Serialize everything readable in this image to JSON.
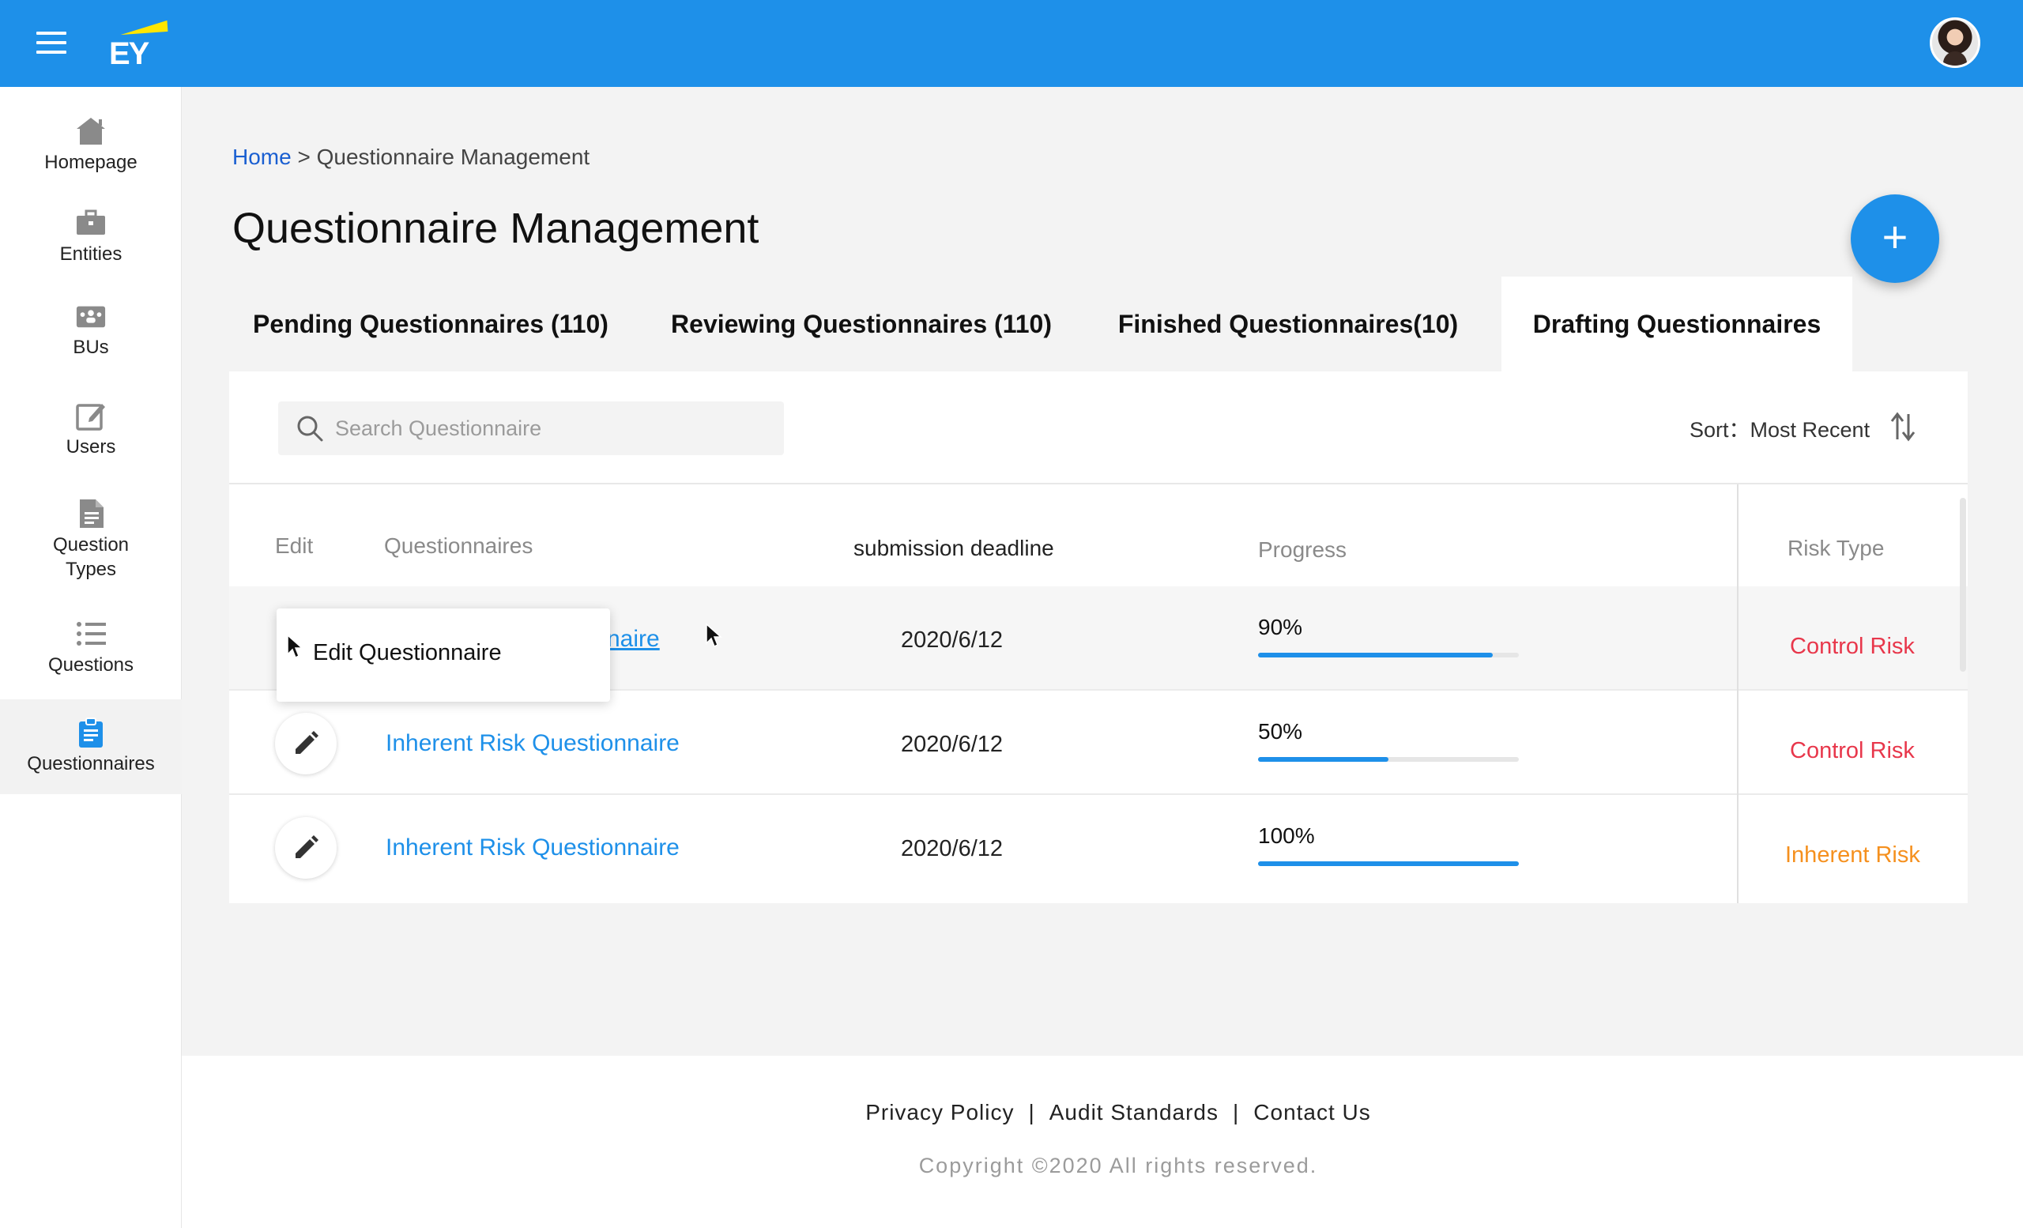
{
  "header": {
    "logo_text": "EY",
    "colors": {
      "bar": "#1e90e9",
      "logo_accent": "#ffe600"
    }
  },
  "sidebar": {
    "items": [
      {
        "label": "Homepage",
        "icon": "home-icon"
      },
      {
        "label": "Entities",
        "icon": "briefcase-icon"
      },
      {
        "label": "BUs",
        "icon": "group-icon"
      },
      {
        "label": "Users",
        "icon": "edit-square-icon"
      },
      {
        "label": "Question Types",
        "icon": "document-icon"
      },
      {
        "label": "Questions",
        "icon": "list-icon"
      },
      {
        "label": "Questionnaires",
        "icon": "clipboard-icon",
        "active": true
      }
    ]
  },
  "breadcrumb": {
    "home": "Home",
    "separator": ">",
    "current": "Questionnaire Management"
  },
  "page_title": "Questionnaire Management",
  "fab_label": "+",
  "tabs": [
    {
      "label": "Pending Questionnaires (110)"
    },
    {
      "label": "Reviewing Questionnaires (110)"
    },
    {
      "label": "Finished Questionnaires(10)"
    },
    {
      "label": "Drafting Questionnaires",
      "active": true
    }
  ],
  "search": {
    "placeholder": "Search Questionnaire",
    "value": ""
  },
  "sort": {
    "label": "Sort：Most Recent"
  },
  "table": {
    "headers": {
      "edit": "Edit",
      "questionnaires": "Questionnaires",
      "deadline": "submission deadline",
      "progress": "Progress",
      "risk_type": "Risk Type"
    },
    "rows": [
      {
        "name": "naire",
        "deadline": "2020/6/12",
        "progress_label": "90%",
        "progress": 0.9,
        "risk": "Control Risk"
      },
      {
        "name": "Inherent Risk Questionnaire",
        "deadline": "2020/6/12",
        "progress_label": "50%",
        "progress": 0.5,
        "risk": "Control Risk"
      },
      {
        "name": "Inherent Risk Questionnaire",
        "deadline": "2020/6/12",
        "progress_label": "100%",
        "progress": 1.0,
        "risk": "Inherent Risk"
      }
    ]
  },
  "tooltip": {
    "label": "Edit Questionnaire"
  },
  "colors": {
    "control_risk": "#e8374b",
    "inherent_risk": "#f5901e",
    "accent": "#1e90e9"
  },
  "footer": {
    "links": [
      "Privacy Policy",
      "Audit Standards",
      "Contact Us"
    ],
    "separator": "|",
    "copyright": "Copyright ©2020 All rights reserved."
  }
}
